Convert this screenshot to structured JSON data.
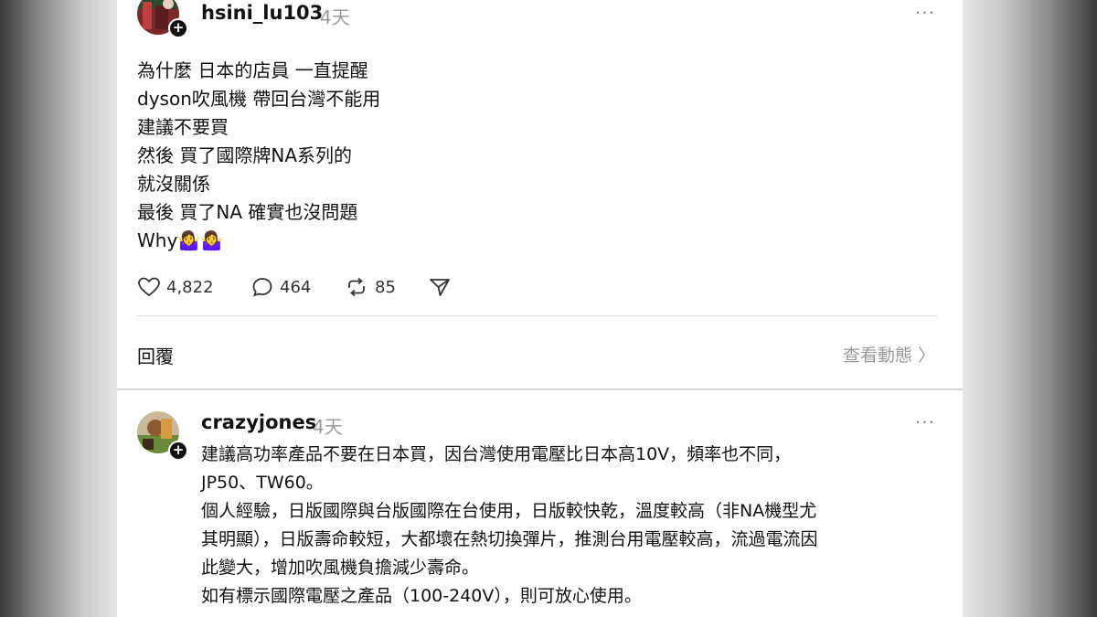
{
  "post": {
    "username": "hsini_lu103",
    "time": "4天",
    "more": "···",
    "lines": [
      "為什麼 日本的店員 一直提醒",
      "dyson吹風機 帶回台灣不能用",
      "建議不要買",
      "然後 買了國際牌NA系列的",
      "就沒關係",
      "最後 買了NA 確實也沒問題",
      "Why🤷‍♀️🤷‍♀️"
    ],
    "actions": {
      "likes": "4,822",
      "comments": "464",
      "reposts": "85"
    }
  },
  "replies_bar": {
    "label": "回覆",
    "view_activity": "查看動態 〉"
  },
  "reply": {
    "username": "crazyjones",
    "time": "4天",
    "more": "···",
    "lines": [
      "建議高功率產品不要在日本買，因台灣使用電壓比日本高10V，頻率也不同，",
      "JP50、TW60。",
      "個人經驗，日版國際與台版國際在台使用，日版較快乾，溫度較高（非NA機型尤",
      "其明顯），日版壽命較短，大都壞在熱切換彈片，推測台用電壓較高，流過電流因",
      "此變大，增加吹風機負擔減少壽命。",
      "如有標示國際電壓之產品（100-240V），則可放心使用。"
    ]
  }
}
